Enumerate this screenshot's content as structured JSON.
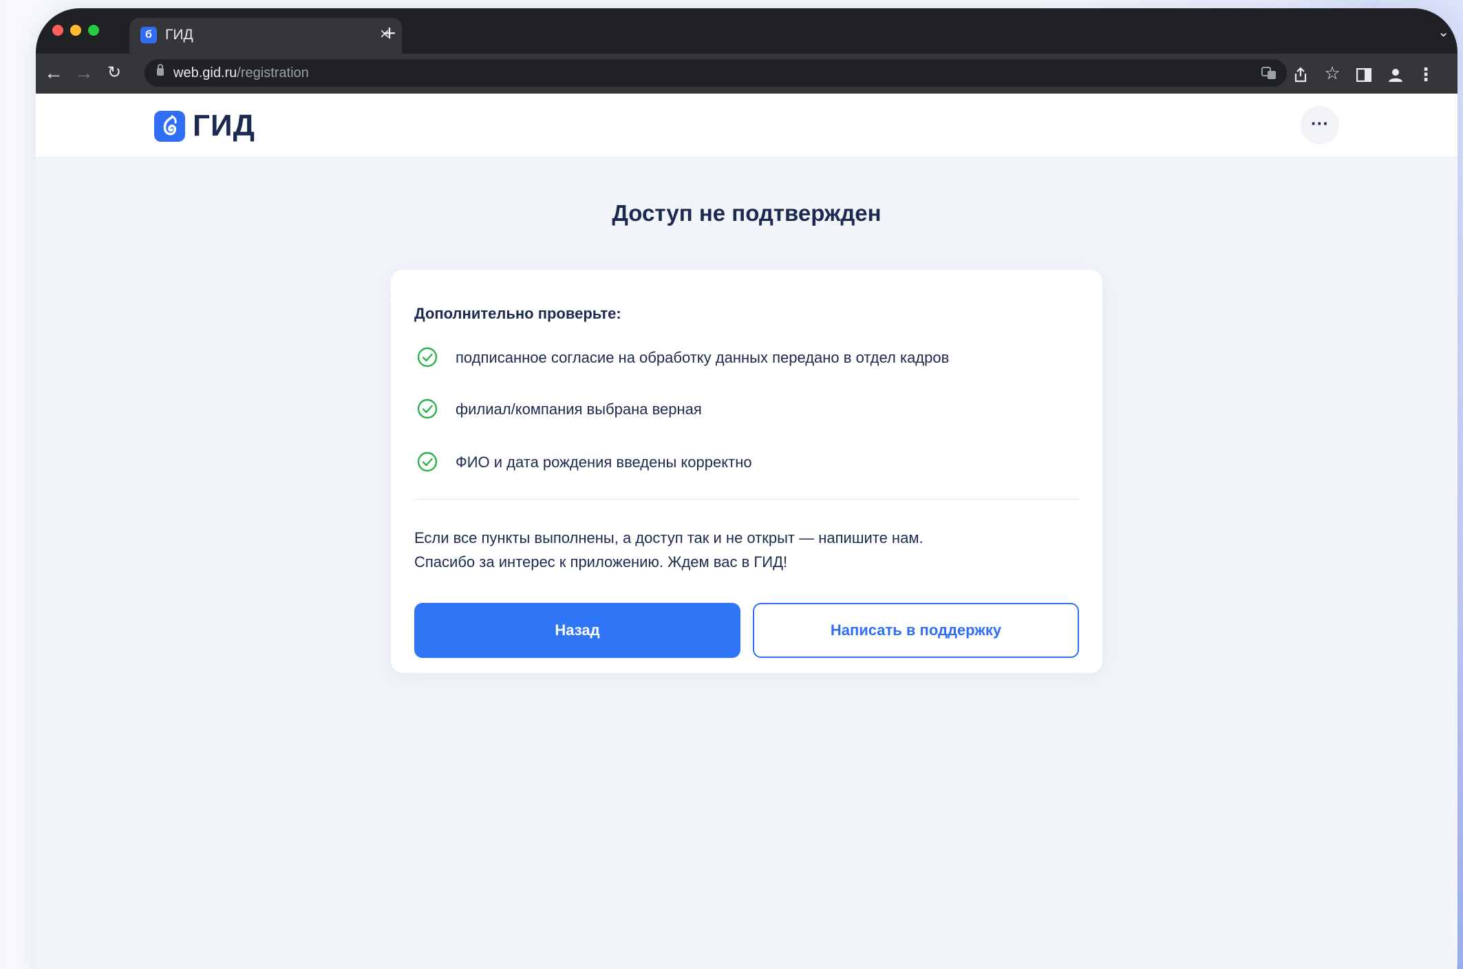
{
  "browser": {
    "tab_title": "ГИД",
    "tab_close": "×",
    "new_tab": "+",
    "url_host": "web.gid.ru",
    "url_path": "/registration",
    "nav": {
      "back_icon": "arrow-left-icon",
      "forward_icon": "arrow-right-icon",
      "reload_icon": "reload-icon"
    },
    "toolbar_icons": [
      "translate-icon",
      "share-icon",
      "star-icon",
      "side-panel-icon",
      "profile-icon",
      "kebab-menu-icon"
    ]
  },
  "header": {
    "logo_text": "ГИД",
    "more_label": "···"
  },
  "main": {
    "title": "Доступ не подтвержден",
    "card": {
      "heading": "Дополнительно проверьте:",
      "items": [
        "подписанное согласие на обработку данных передано в отдел кадров",
        "филиал/компания выбрана верная",
        "ФИО и дата рождения введены корректно"
      ],
      "note_line1": "Если все пункты выполнены, а доступ так и не открыт — напишите нам.",
      "note_line2": "Спасибо за интерес к приложению. Ждем вас в ГИД!",
      "back_button": "Назад",
      "support_button": "Написать в поддержку"
    }
  },
  "colors": {
    "accent": "#2f75f5",
    "check": "#2bb34a",
    "text": "#1b2a4e",
    "chrome_dark": "#202124",
    "chrome_toolbar": "#35363a"
  }
}
